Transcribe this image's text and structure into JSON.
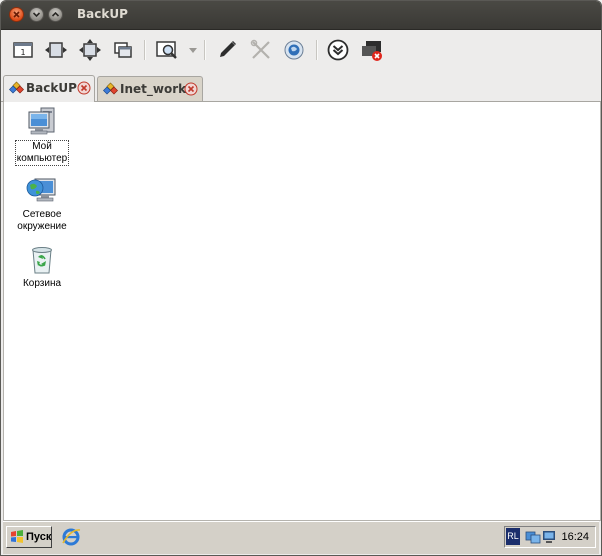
{
  "window": {
    "title": "BackUP"
  },
  "toolbar": {
    "buttons": [
      {
        "icon": "fit-screen-icon"
      },
      {
        "icon": "scale-width-icon"
      },
      {
        "icon": "scale-both-icon"
      },
      {
        "icon": "windows-icon"
      },
      {
        "icon": "zoom-icon"
      },
      {
        "icon": "dropdown-arrow-icon"
      },
      {
        "icon": "pen-icon"
      },
      {
        "icon": "tools-icon"
      },
      {
        "icon": "globe-icon"
      },
      {
        "icon": "download-circle-icon"
      },
      {
        "icon": "disconnect-icon"
      }
    ]
  },
  "tabs": [
    {
      "label": "BackUP",
      "active": true
    },
    {
      "label": "Inet_work",
      "active": false
    }
  ],
  "desktop": {
    "icons": [
      {
        "label_line1": "Мой",
        "label_line2": "компьютер",
        "icon": "my-computer-icon"
      },
      {
        "label_line1": "Сетевое",
        "label_line2": "окружение",
        "icon": "network-places-icon"
      },
      {
        "label_line1": "Корзина",
        "label_line2": "",
        "icon": "recycle-bin-icon"
      }
    ]
  },
  "taskbar": {
    "start_label": "Пуск",
    "language": "RL",
    "clock": "16:24"
  }
}
